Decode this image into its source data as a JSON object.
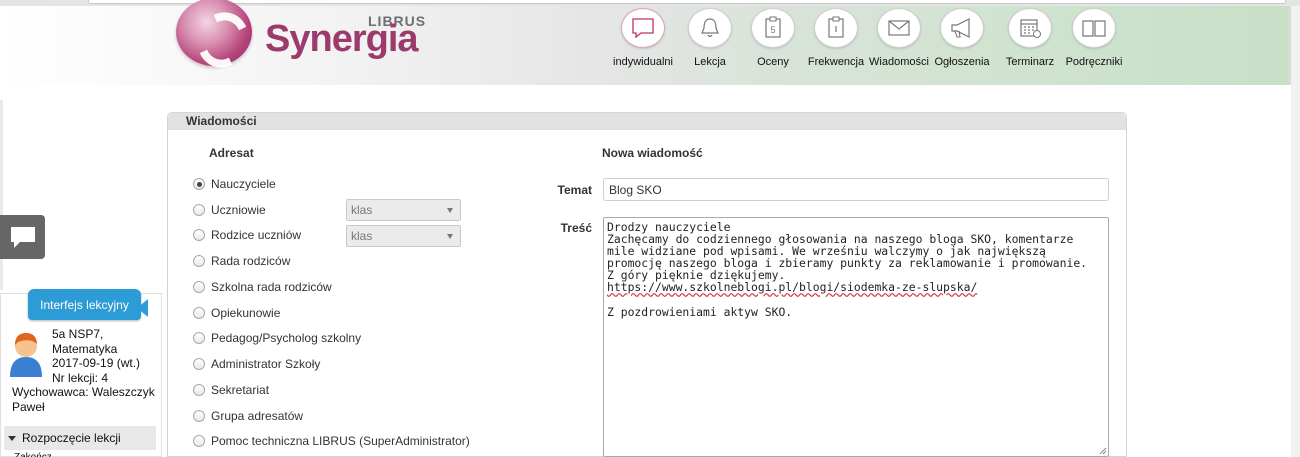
{
  "header": {
    "logo_librus": "LIBRUS",
    "logo_synergia": "Synergia",
    "nav": [
      {
        "label": "indywidualni",
        "icon": "chat-bubble-icon"
      },
      {
        "label": "Lekcja",
        "icon": "bell-icon"
      },
      {
        "label": "Oceny",
        "icon": "grade-card-icon"
      },
      {
        "label": "Frekwencja",
        "icon": "attendance-clipboard-icon"
      },
      {
        "label": "Wiadomości",
        "icon": "envelope-icon"
      },
      {
        "label": "Ogłoszenia",
        "icon": "megaphone-icon"
      },
      {
        "label": "Terminarz",
        "icon": "calendar-icon"
      },
      {
        "label": "Podręczniki",
        "icon": "book-icon"
      }
    ]
  },
  "sidebar": {
    "tab_label": "Interfejs lekcyjny",
    "lesson": {
      "class": "5a NSP7,",
      "subject": "Matematyka",
      "date": "2017-09-19 (wt.)",
      "lesson_no": "Nr lekcji: 4"
    },
    "teacher": "Wychowawca: Waleszczyk Paweł",
    "section": "Rozpoczęcie lekcji",
    "more": "Zakończ lekcję"
  },
  "panel": {
    "title": "Wiadomości",
    "recipients_title": "Adresat",
    "new_message_title": "Nowa wiadomość",
    "recipients": [
      {
        "label": "Nauczyciele",
        "checked": true
      },
      {
        "label": "Uczniowie",
        "checked": false,
        "select": "klas"
      },
      {
        "label": "Rodzice uczniów",
        "checked": false,
        "select": "klas"
      },
      {
        "label": "Rada rodziców",
        "checked": false
      },
      {
        "label": "Szkolna rada rodziców",
        "checked": false
      },
      {
        "label": "Opiekunowie",
        "checked": false
      },
      {
        "label": "Pedagog/Psycholog szkolny",
        "checked": false
      },
      {
        "label": "Administrator Szkoły",
        "checked": false
      },
      {
        "label": "Sekretariat",
        "checked": false
      },
      {
        "label": "Grupa adresatów",
        "checked": false
      },
      {
        "label": "Pomoc techniczna LIBRUS (SuperAdministrator)",
        "checked": false
      }
    ],
    "subject_label": "Temat",
    "subject_value": "Blog SKO",
    "body_label": "Treść",
    "body_lines": [
      "Drodzy nauczyciele",
      "Zachęcamy do codziennego głosowania na naszego bloga SKO, komentarze",
      "mile widziane pod wpisami. We wrześniu walczymy o jak największą",
      "promocję naszego bloga i zbieramy punkty za reklamowanie i promowanie.",
      "Z góry pięknie dziękujemy.",
      "https://www.szkolneblogi.pl/blogi/siodemka-ze-slupska/",
      "",
      "Z pozdrowieniami aktyw SKO."
    ]
  }
}
